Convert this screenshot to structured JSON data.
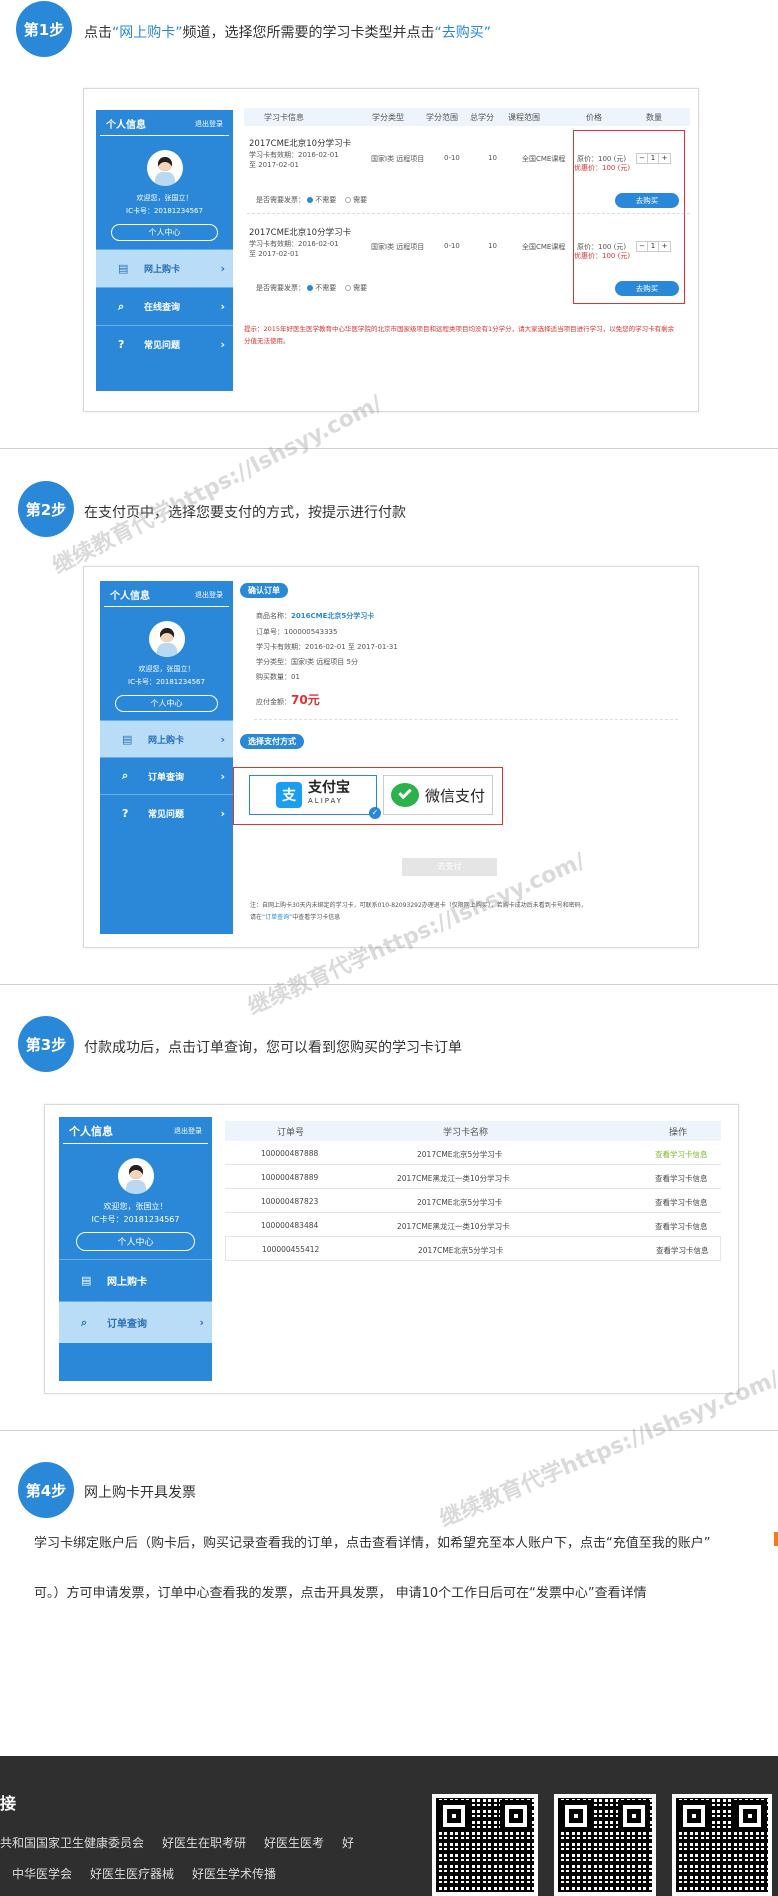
{
  "step1": {
    "badge": "第1步",
    "pre": "点击",
    "q1": "“",
    "link1": "网上购卡",
    "q2": "”",
    "mid": "频道，选择您所需要的学习卡类型并点击",
    "q3": "“",
    "link2": "去购买",
    "q4": "”"
  },
  "sidebar": {
    "title": "个人信息",
    "logout": "退出登录",
    "welcome": "欢迎您，张国立！",
    "ic": "IC卡号：20181234567",
    "center": "个人中心",
    "menu1": [
      "网上购卡",
      "在线查询",
      "常见问题"
    ],
    "menu2": [
      "网上购卡",
      "订单查询",
      "常见问题"
    ],
    "menu3": [
      "网上购卡",
      "订单查询"
    ]
  },
  "shop": {
    "headers": [
      "学习卡信息",
      "学分类型",
      "学分范围",
      "总学分",
      "课程范围",
      "价格",
      "数量"
    ],
    "cards": [
      {
        "name": "2017CME北京10分学习卡",
        "validity": "学习卡有效期：2016-02-01",
        "validity2": "至 2017-02-01",
        "type": "国家I类 远程项目",
        "range": "0-10",
        "total": "10",
        "scope": "全国CME课程",
        "orig": "原价：100 (元)",
        "deal": "优惠价：100 (元)",
        "invoice": "是否需要发票：",
        "no": "不需要",
        "yes": "需要",
        "qty": "1",
        "minus": "−",
        "plus": "+",
        "buy": "去购买"
      },
      {
        "name": "2017CME北京10分学习卡",
        "validity": "学习卡有效期：2016-02-01",
        "validity2": "至 2017-02-01",
        "type": "国家I类 远程项目",
        "range": "0-10",
        "total": "10",
        "scope": "全国CME课程",
        "orig": "原价：100 (元)",
        "deal": "优惠价：100 (元)",
        "invoice": "是否需要发票：",
        "no": "不需要",
        "yes": "需要",
        "qty": "1",
        "minus": "−",
        "plus": "+",
        "buy": "去购买"
      }
    ],
    "note1": "提示：2015年好医生医学教育中心华医学院的北京市国家级项目和远程类项目均没有1分学分，请大家选择适当项目进行学习，以免您的学习卡有剩余",
    "note2": "分值无法使用。"
  },
  "step2": {
    "badge": "第2步",
    "text": "在支付页中，选择您要支付的方式，按提示进行付款"
  },
  "order": {
    "confirm": "确认订单",
    "product_label": "商品名称：",
    "product": "2016CME北京5分学习卡",
    "order_no": "订单号：100000543335",
    "valid": "学习卡有效期：2016-02-01 至 2017-01-31",
    "ctype": "学分类型：国家I类 远程项目    5分",
    "count": "购买数量：01",
    "due_label": "应付金额：",
    "due": "70元",
    "paymethod": "选择支付方式",
    "alipay": "支付宝",
    "alipay_sub": "ALIPAY",
    "alipay_mark": "支",
    "wechat": "微信支付",
    "pay_btn": "去支付",
    "fn1": "注：自网上购卡30天内未绑定的学习卡，可联系010-82093292办理退卡（仅限网上购买），若购卡成功后未看到卡号和密码，",
    "fn2": "请在",
    "fn_link": "“订单查询”",
    "fn3": "中查看学习卡信息",
    "check": "✓"
  },
  "step3": {
    "badge": "第3步",
    "text": "付款成功后，点击订单查询，您可以看到您购买的学习卡订单"
  },
  "orders": {
    "headers": [
      "订单号",
      "学习卡名称",
      "操作"
    ],
    "rows": [
      {
        "no": "100000487888",
        "name": "2017CME北京5分学习卡",
        "op": "查看学习卡信息"
      },
      {
        "no": "100000487889",
        "name": "2017CME黑龙江一类10分学习卡",
        "op": "查看学习卡信息"
      },
      {
        "no": "100000487823",
        "name": "2017CME北京5分学习卡",
        "op": "查看学习卡信息"
      },
      {
        "no": "100000483484",
        "name": "2017CME黑龙江一类10分学习卡",
        "op": "查看学习卡信息"
      },
      {
        "no": "100000455412",
        "name": "2017CME北京5分学习卡",
        "op": "查看学习卡信息"
      }
    ]
  },
  "step4": {
    "badge": "第4步",
    "title": "网上购卡开具发票",
    "p1": "学习卡绑定账户后（购卡后，购买记录查看我的订单，点击查看详情，如希望充至本人账户下，点击“充值至我的账户”",
    "p2": "可。）方可申请发票，订单中心查看我的发票，点击开具发票， 申请10个工作日后可在“发票中心”查看详情"
  },
  "watermark": "继续教育代学https://lshsyy.com/",
  "footer": {
    "title": "接",
    "links1": [
      "共和国国家卫生健康委员会",
      "好医生在职考研",
      "好医生医考",
      "好"
    ],
    "links2": [
      "中华医学会",
      "好医生医疗器械",
      "好医生学术传播"
    ]
  },
  "icons": {
    "chevron": "›",
    "cart": "🛒",
    "search": "🔍",
    "help": "?"
  },
  "colors": {
    "accent": "#2a88d8",
    "red": "#e03030",
    "orange": "#f07c1a"
  }
}
